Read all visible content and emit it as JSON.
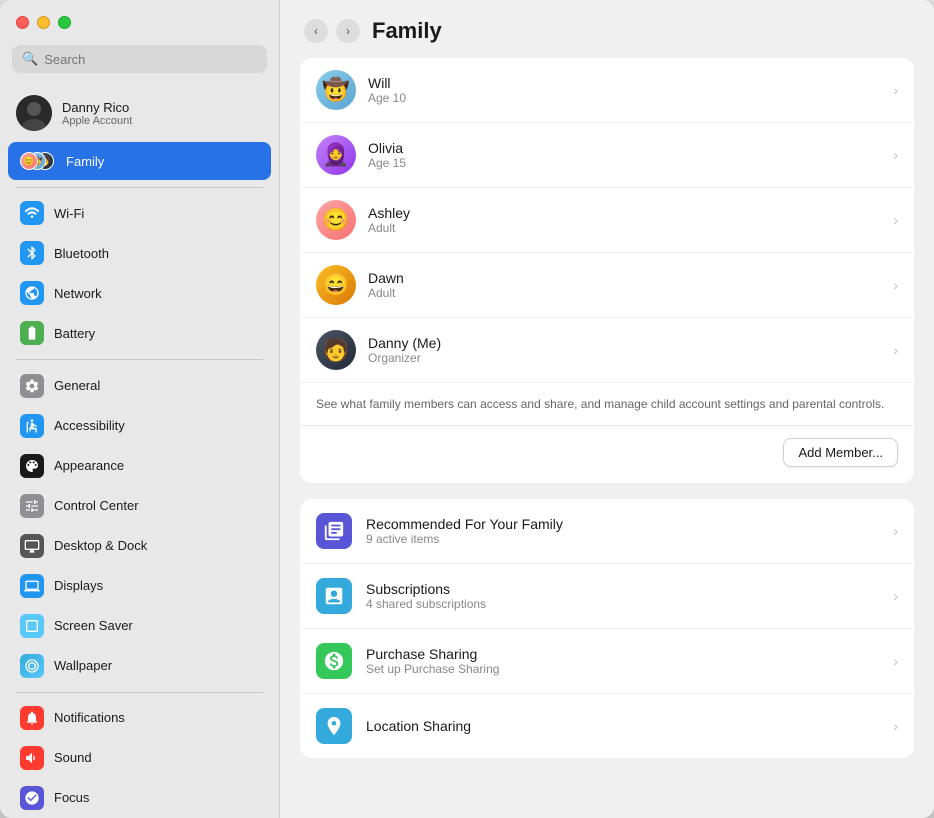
{
  "window": {
    "title": "Family"
  },
  "trafficLights": {
    "close": "close",
    "minimize": "minimize",
    "maximize": "maximize"
  },
  "search": {
    "placeholder": "Search"
  },
  "account": {
    "name": "Danny Rico",
    "subtitle": "Apple Account"
  },
  "sidebar": {
    "family_label": "Family",
    "items": [
      {
        "id": "wifi",
        "label": "Wi-Fi",
        "icon": "wifi",
        "color": "#2196F3"
      },
      {
        "id": "bluetooth",
        "label": "Bluetooth",
        "icon": "bluetooth",
        "color": "#2196F3"
      },
      {
        "id": "network",
        "label": "Network",
        "icon": "network",
        "color": "#2196F3"
      },
      {
        "id": "battery",
        "label": "Battery",
        "icon": "battery",
        "color": "#4CAF50"
      },
      {
        "id": "general",
        "label": "General",
        "icon": "general",
        "color": "#888"
      },
      {
        "id": "accessibility",
        "label": "Accessibility",
        "icon": "accessibility",
        "color": "#2196F3"
      },
      {
        "id": "appearance",
        "label": "Appearance",
        "icon": "appearance",
        "color": "#1a1a1a"
      },
      {
        "id": "control-center",
        "label": "Control Center",
        "icon": "control-center",
        "color": "#888"
      },
      {
        "id": "desktop-dock",
        "label": "Desktop & Dock",
        "icon": "desktop-dock",
        "color": "#555"
      },
      {
        "id": "displays",
        "label": "Displays",
        "icon": "displays",
        "color": "#2196F3"
      },
      {
        "id": "screen-saver",
        "label": "Screen Saver",
        "icon": "screen-saver",
        "color": "#5AC8FA"
      },
      {
        "id": "wallpaper",
        "label": "Wallpaper",
        "icon": "wallpaper",
        "color": "#34aadc"
      },
      {
        "id": "notifications",
        "label": "Notifications",
        "icon": "notifications",
        "color": "#FF3B30"
      },
      {
        "id": "sound",
        "label": "Sound",
        "icon": "sound",
        "color": "#FF3B30"
      },
      {
        "id": "focus",
        "label": "Focus",
        "icon": "focus",
        "color": "#5856D6"
      }
    ]
  },
  "header": {
    "title": "Family",
    "back_label": "<",
    "forward_label": ">"
  },
  "family_members": [
    {
      "name": "Will",
      "detail": "Age 10",
      "avatar_class": "avatar-will",
      "emoji": "🤠"
    },
    {
      "name": "Olivia",
      "detail": "Age 15",
      "avatar_class": "avatar-olivia",
      "emoji": "🧕"
    },
    {
      "name": "Ashley",
      "detail": "Adult",
      "avatar_class": "avatar-ashley",
      "emoji": "😊"
    },
    {
      "name": "Dawn",
      "detail": "Adult",
      "avatar_class": "avatar-dawn",
      "emoji": "😄"
    },
    {
      "name": "Danny (Me)",
      "detail": "Organizer",
      "avatar_class": "avatar-danny",
      "emoji": "🧑"
    }
  ],
  "description": "See what family members can access and share, and manage child account settings and parental controls.",
  "add_member_label": "Add Member...",
  "features": [
    {
      "id": "recommended",
      "name": "Recommended For Your Family",
      "detail": "9 active items",
      "icon_color": "#5856D6",
      "icon_emoji": "🎮"
    },
    {
      "id": "subscriptions",
      "name": "Subscriptions",
      "detail": "4 shared subscriptions",
      "icon_color": "#34aadc",
      "icon_emoji": "✚"
    },
    {
      "id": "purchase-sharing",
      "name": "Purchase Sharing",
      "detail": "Set up Purchase Sharing",
      "icon_color": "#34c759",
      "icon_emoji": "P"
    },
    {
      "id": "location-sharing",
      "name": "Location Sharing",
      "detail": "",
      "icon_color": "#34aadc",
      "icon_emoji": "▲"
    }
  ]
}
